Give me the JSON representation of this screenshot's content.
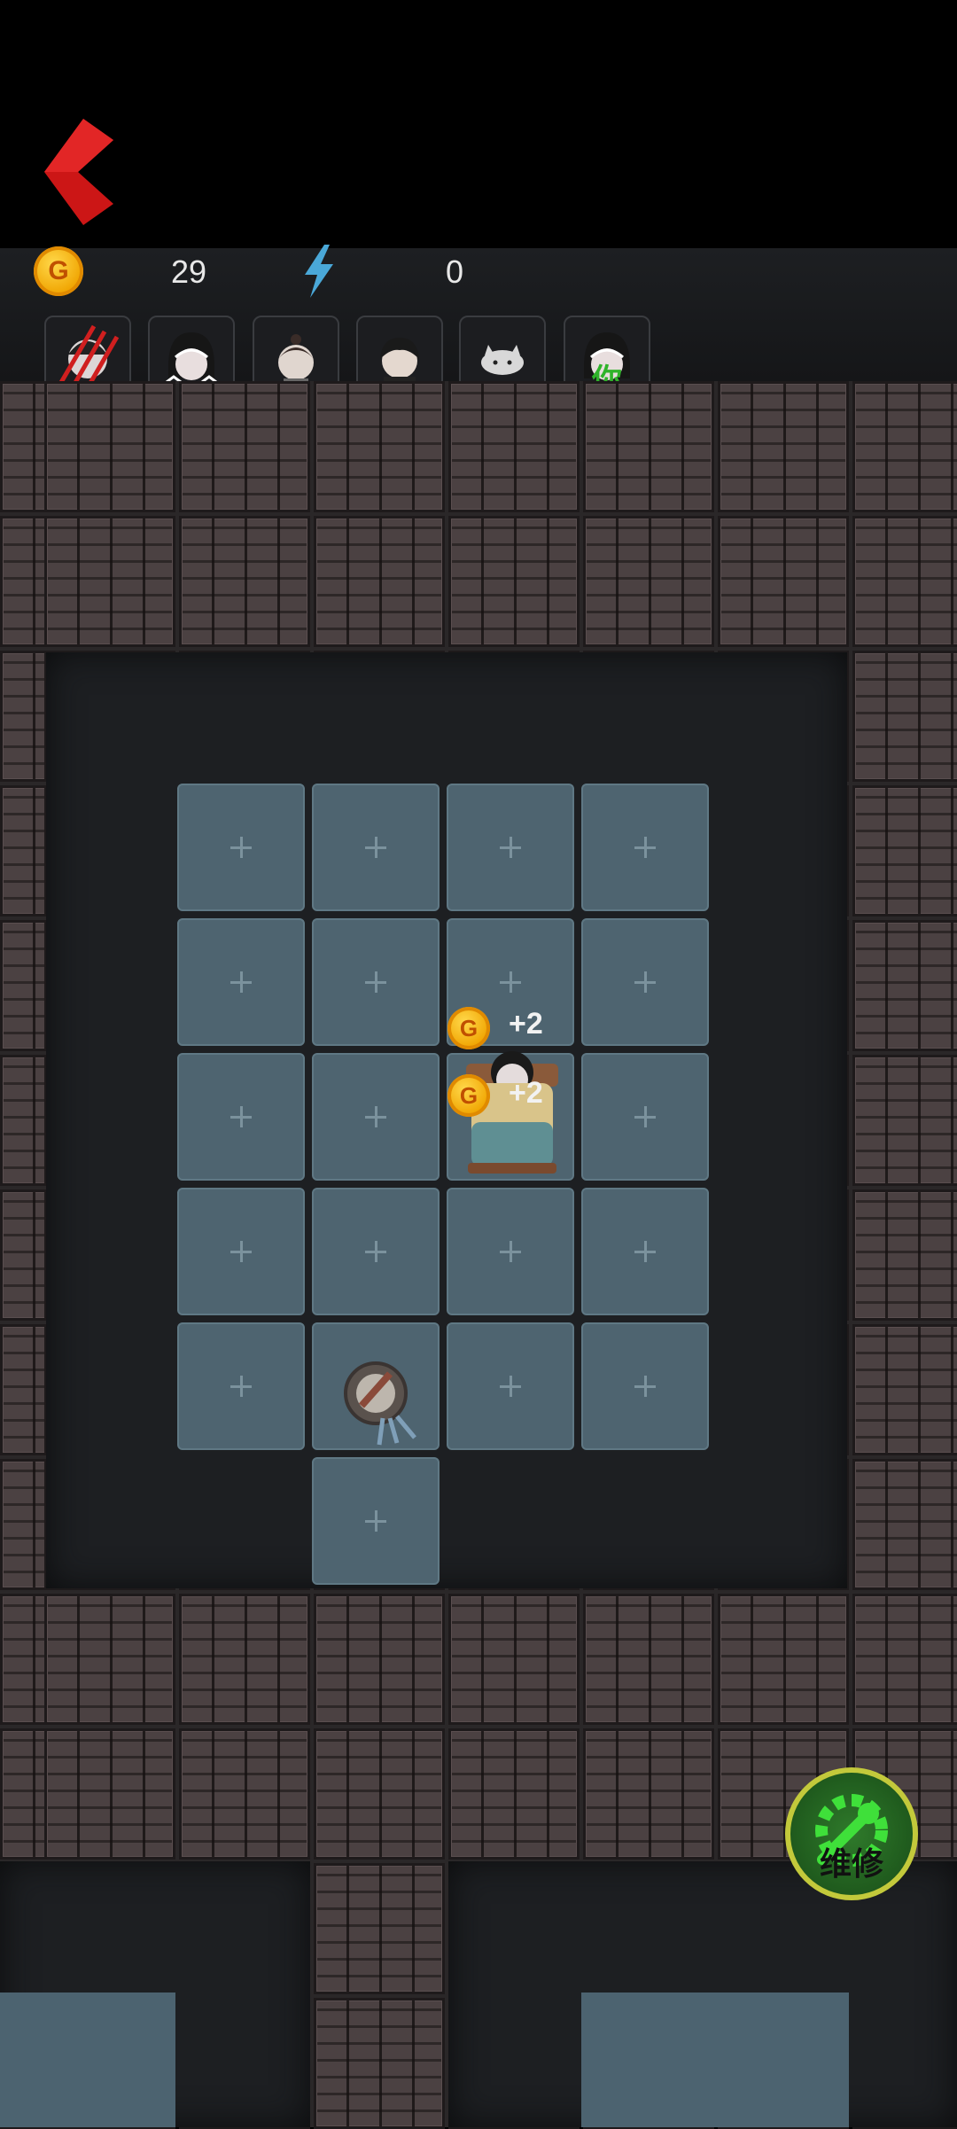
{
  "hud": {
    "coin_symbol": "G",
    "coins": "29",
    "energy": "0"
  },
  "players": [
    {
      "name": "ghost-slashed-avatar",
      "label": ""
    },
    {
      "name": "girl-avatar",
      "label": ""
    },
    {
      "name": "boy-avatar",
      "label": ""
    },
    {
      "name": "man-avatar",
      "label": ""
    },
    {
      "name": "cat-avatar",
      "label": ""
    },
    {
      "name": "you-avatar",
      "label": "你"
    }
  ],
  "room": {
    "gains": [
      "+2",
      "+2"
    ]
  },
  "repair_button": {
    "label": "维修"
  },
  "colors": {
    "accent_red": "#cc1616",
    "energy_blue": "#4aa8d8",
    "repair_green": "#3fe03a",
    "you_label_green": "#2fb32a"
  },
  "icons": [
    "back-arrow-icon",
    "coin-icon",
    "lightning-icon",
    "wrench-gear-icon",
    "bed-icon",
    "turret-icon"
  ]
}
